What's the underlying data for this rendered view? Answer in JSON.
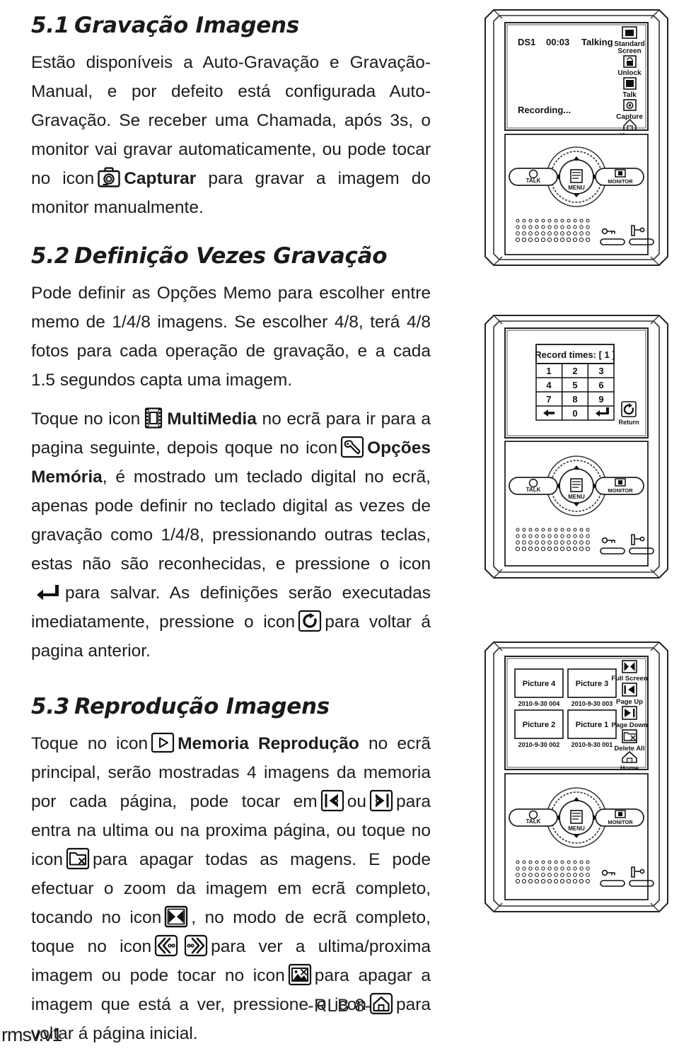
{
  "document": {
    "footer_page_label": "-RLB 8-",
    "watermark": "rmsv.v1"
  },
  "sections": [
    {
      "id": "5.1",
      "number": "5.1",
      "title": "Gravação Imagens",
      "body_1": "Estão disponíveis a Auto-Gravação e Gravação-Manual, e por defeito está configurada Auto-Gravação. Se receber uma Chamada, após 3s, o monitor vai gravar automaticamente, ou pode tocar no icon",
      "icon_1_label": "camera-capture-icon",
      "body_1b_bold": "Capturar",
      "body_1c": "para gravar a imagem do monitor manualmente."
    },
    {
      "id": "5.2",
      "number": "5.2",
      "title": "Definição Vezes Gravação",
      "body_1": "Pode definir as Opções Memo para escolher entre memo de 1/4/8 imagens. Se escolher 4/8, terá 4/8 fotos para cada operação de gravação, e a cada 1.5 segundos capta uma imagem.",
      "p2_a": "Toque no icon",
      "p2_bold_1": "MultiMedia",
      "p2_b": "no ecrã para ir para a pagina seguinte, depois qoque no icon",
      "p2_bold_2": "Opções Memória",
      "p2_c": ", é mostrado um teclado digital no ecrã, apenas pode definir no teclado digital as vezes de gravação como 1/4/8, pressionando outras teclas, estas não são reconhecidas, e pressione o icon",
      "p2_d": "para salvar. As definições serão executadas imediatamente, pressione o icon",
      "p2_e": "para voltar á pagina anterior."
    },
    {
      "id": "5.3",
      "number": "5.3",
      "title": "Reprodução Imagens",
      "p_a": "Toque no icon",
      "p_bold_1": "Memoria Reprodução",
      "p_b": "no ecrã principal, serão mostradas 4 imagens da memoria por cada página, pode tocar em",
      "p_or": "ou",
      "p_c": "para entra na ultima ou na proxima página, ou toque no icon",
      "p_d": "para apagar todas as magens. E pode efectuar o zoom da imagem em ecrã completo, tocando no icon",
      "p_e": ", no modo de ecrã completo, toque no icon",
      "p_f": "para ver a ultima/proxima imagem ou pode tocar no icon",
      "p_g": "para apagar a imagem que está a ver, pressione o icon",
      "p_h": "para voltar á página inicial."
    }
  ],
  "inline_icons": {
    "capture": "camera-capture-icon",
    "multimedia": "film-strip-icon",
    "memory_options": "wrench-icon",
    "save_enter": "enter-return-arrow-icon",
    "back_return": "circular-return-arrow-icon",
    "memory_playback": "play-triangle-icon",
    "page_up": "page-up-icon",
    "page_down": "page-down-icon",
    "delete_all": "folder-delete-icon",
    "full_screen": "full-screen-icon",
    "prev_image": "previous-image-icon",
    "next_image": "next-image-icon",
    "delete_image": "picture-delete-icon",
    "home": "home-icon"
  },
  "devices": [
    {
      "name": "device-talking-recording",
      "screen": {
        "status_line": {
          "channel": "DS1",
          "time": "00:03",
          "state": "Talking"
        },
        "status_message": "Recording...",
        "side_buttons": [
          {
            "icon": "standard-screen-icon",
            "label_line1": "Standard",
            "label_line2": "Screen"
          },
          {
            "icon": "lock-icon",
            "label_line1": "Unlock",
            "label_line2": ""
          },
          {
            "icon": "talk-icon",
            "label_line1": "Talk",
            "label_line2": ""
          },
          {
            "icon": "camera-capture-icon",
            "label_line1": "Capture",
            "label_line2": ""
          },
          {
            "icon": "home-icon",
            "label_line1": "Home",
            "label_line2": ""
          }
        ]
      },
      "panel": {
        "left_button": "TALK",
        "center_button": "MENU",
        "right_button": "MONITOR"
      }
    },
    {
      "name": "device-record-times-keypad",
      "screen": {
        "keypad_title": "Record times: [ 1 ]",
        "keypad_rows": [
          [
            "1",
            "2",
            "3"
          ],
          [
            "4",
            "5",
            "6"
          ],
          [
            "7",
            "8",
            "9"
          ],
          [
            "back",
            "0",
            "enter"
          ]
        ],
        "side_buttons": [
          {
            "icon": "circular-return-arrow-icon",
            "label_line1": "Return",
            "label_line2": ""
          }
        ]
      },
      "panel": {
        "left_button": "TALK",
        "center_button": "MENU",
        "right_button": "MONITOR"
      }
    },
    {
      "name": "device-picture-gallery",
      "screen": {
        "pictures": [
          {
            "label": "Picture 4",
            "timestamp": "2010-9-30 004"
          },
          {
            "label": "Picture 3",
            "timestamp": "2010-9-30 003"
          },
          {
            "label": "Picture 2",
            "timestamp": "2010-9-30 002"
          },
          {
            "label": "Picture 1",
            "timestamp": "2010-9-30 001"
          }
        ],
        "side_buttons": [
          {
            "icon": "full-screen-icon",
            "label_line1": "Full Screen",
            "label_line2": ""
          },
          {
            "icon": "page-up-icon",
            "label_line1": "Page Up",
            "label_line2": ""
          },
          {
            "icon": "page-down-icon",
            "label_line1": "Page Down",
            "label_line2": ""
          },
          {
            "icon": "folder-delete-icon",
            "label_line1": "Delete All",
            "label_line2": ""
          },
          {
            "icon": "home-icon",
            "label_line1": "Home",
            "label_line2": ""
          }
        ]
      },
      "panel": {
        "left_button": "TALK",
        "center_button": "MENU",
        "right_button": "MONITOR"
      }
    }
  ]
}
